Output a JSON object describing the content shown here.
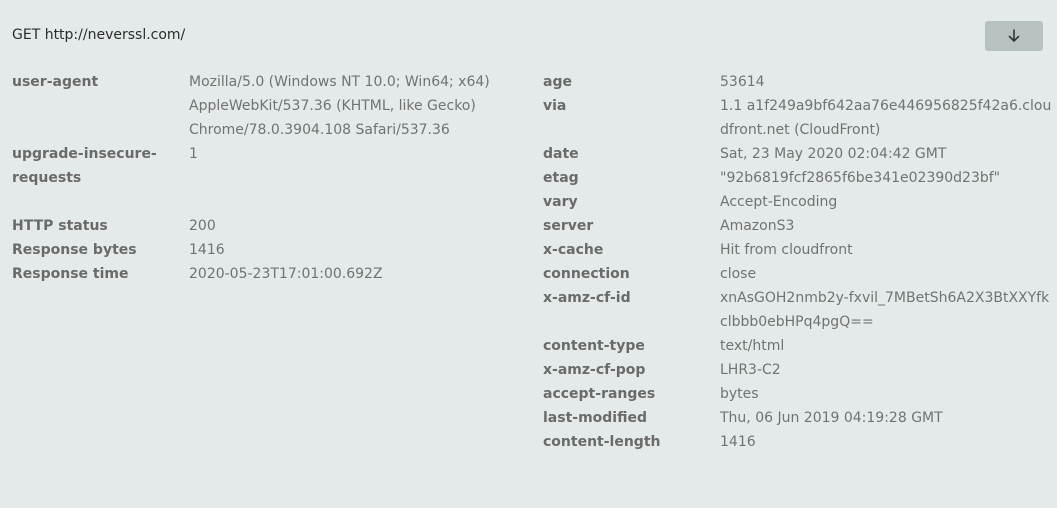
{
  "request": {
    "line": "GET http://neverssl.com/"
  },
  "toggle": {
    "icon": "arrow-down-icon"
  },
  "request_headers": [
    {
      "key": "user-agent",
      "value": "Mozilla/5.0 (Windows NT 10.0; Win64; x64) AppleWebKit/537.36 (KHTML, like Gecko) Chrome/78.0.3904.108 Safari/537.36"
    },
    {
      "key": "upgrade-insecure-requests",
      "value": "1"
    }
  ],
  "response_summary": [
    {
      "key": "HTTP status",
      "value": "200"
    },
    {
      "key": "Response bytes",
      "value": "1416"
    },
    {
      "key": "Response time",
      "value": "2020-05-23T17:01:00.692Z"
    }
  ],
  "response_headers": [
    {
      "key": "age",
      "value": "53614"
    },
    {
      "key": "via",
      "value": "1.1 a1f249a9bf642aa76e446956825f42a6.cloudfront.net (CloudFront)"
    },
    {
      "key": "date",
      "value": "Sat, 23 May 2020 02:04:42 GMT"
    },
    {
      "key": "etag",
      "value": "\"92b6819fcf2865f6be341e02390d23bf\""
    },
    {
      "key": "vary",
      "value": "Accept-Encoding"
    },
    {
      "key": "server",
      "value": "AmazonS3"
    },
    {
      "key": "x-cache",
      "value": "Hit from cloudfront"
    },
    {
      "key": "connection",
      "value": "close"
    },
    {
      "key": "x-amz-cf-id",
      "value": "xnAsGOH2nmb2y-fxvil_7MBetSh6A2X3BtXXYfkclbbb0ebHPq4pgQ=="
    },
    {
      "key": "content-type",
      "value": "text/html"
    },
    {
      "key": "x-amz-cf-pop",
      "value": "LHR3-C2"
    },
    {
      "key": "accept-ranges",
      "value": "bytes"
    },
    {
      "key": "last-modified",
      "value": "Thu, 06 Jun 2019 04:19:28 GMT"
    },
    {
      "key": "content-length",
      "value": "1416"
    }
  ]
}
